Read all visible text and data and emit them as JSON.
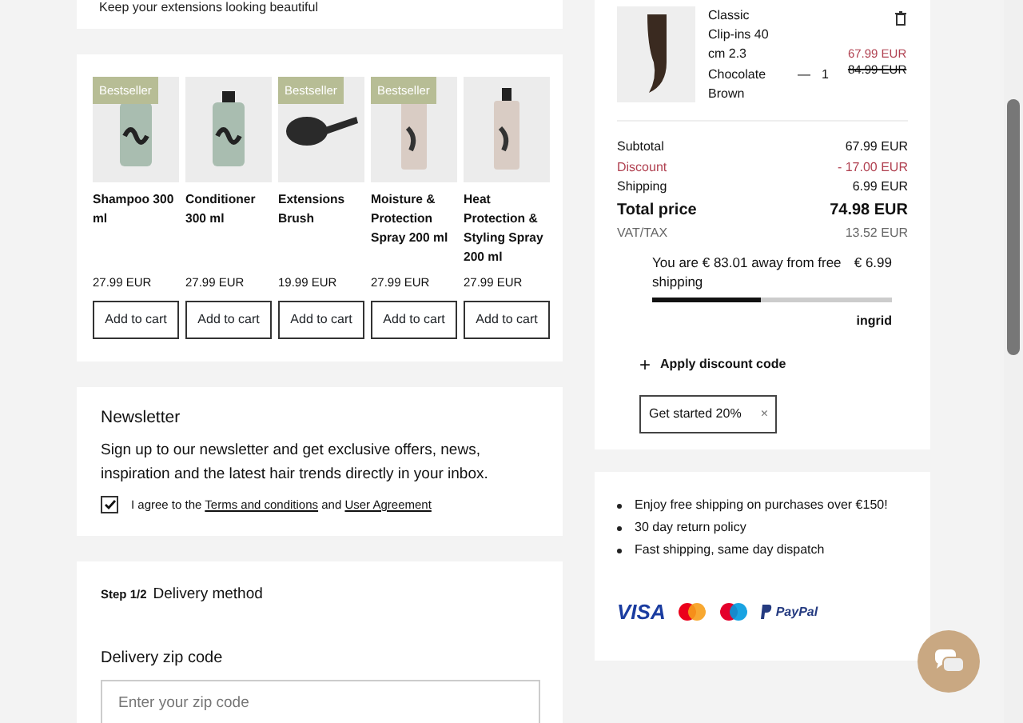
{
  "top_strip": {
    "text": "Keep your extensions looking beautiful"
  },
  "products": [
    {
      "name": "Shampoo 300 ml",
      "price": "27.99 EUR",
      "badge": "Bestseller",
      "kind": "bottle",
      "button": "Add to cart"
    },
    {
      "name": "Conditioner 300 ml",
      "price": "27.99 EUR",
      "kind": "bottle",
      "button": "Add to cart"
    },
    {
      "name": "Extensions Brush",
      "price": "19.99 EUR",
      "badge": "Bestseller",
      "kind": "brush",
      "button": "Add to cart"
    },
    {
      "name": "Moisture & Protection Spray 200 ml",
      "price": "27.99 EUR",
      "badge": "Bestseller",
      "kind": "spray",
      "button": "Add to cart"
    },
    {
      "name": "Heat Protection & Styling Spray 200 ml",
      "price": "27.99 EUR",
      "kind": "spray",
      "button": "Add to cart"
    }
  ],
  "newsletter": {
    "title": "Newsletter",
    "text": "Sign up to our newsletter and get exclusive offers, news, inspiration and the latest hair trends directly in your inbox.",
    "consent": {
      "checked": true,
      "prefix": "I agree to the",
      "link_1": "Terms and conditions",
      "middle": "and",
      "link_2": "User Agreement"
    }
  },
  "delivery": {
    "step": "Step 1/2",
    "title": "Delivery method",
    "zip_label": "Delivery zip code",
    "zip_placeholder": "Enter your zip code"
  },
  "cart_item": {
    "name": "Classic Clip-ins 40 cm 2.3 Chocolate Brown",
    "minus": "—",
    "quantity": "1",
    "price": "67.99 EUR",
    "old_price": "84.99 EUR"
  },
  "summary": [
    {
      "label": "Subtotal",
      "value": "67.99 EUR",
      "kind": "normal"
    },
    {
      "label": "Discount",
      "value": "- 17.00 EUR",
      "kind": "discount"
    },
    {
      "label": "Shipping",
      "value": "6.99 EUR",
      "kind": "normal"
    },
    {
      "label": "Total price",
      "value": "74.98 EUR",
      "kind": "total"
    },
    {
      "label": "VAT/TAX",
      "value": "13.52 EUR",
      "kind": "muted"
    }
  ],
  "free_shipping": {
    "text": "You are € 83.01 away from free shipping",
    "amount": "€ 6.99",
    "level": 0.45,
    "brand": "ingrid"
  },
  "discount": {
    "toggle": "+",
    "label": "Apply discount code",
    "code": "Get started 20%",
    "remove": "×"
  },
  "perks": [
    "Enjoy free shipping on purchases over €150!",
    "30 day return policy",
    "Fast shipping, same day dispatch"
  ],
  "payments": [
    {
      "kind": "visa",
      "text": "VISA"
    },
    {
      "kind": "mastercard"
    },
    {
      "kind": "maestro"
    },
    {
      "kind": "paypal",
      "text": "PayPal"
    }
  ]
}
